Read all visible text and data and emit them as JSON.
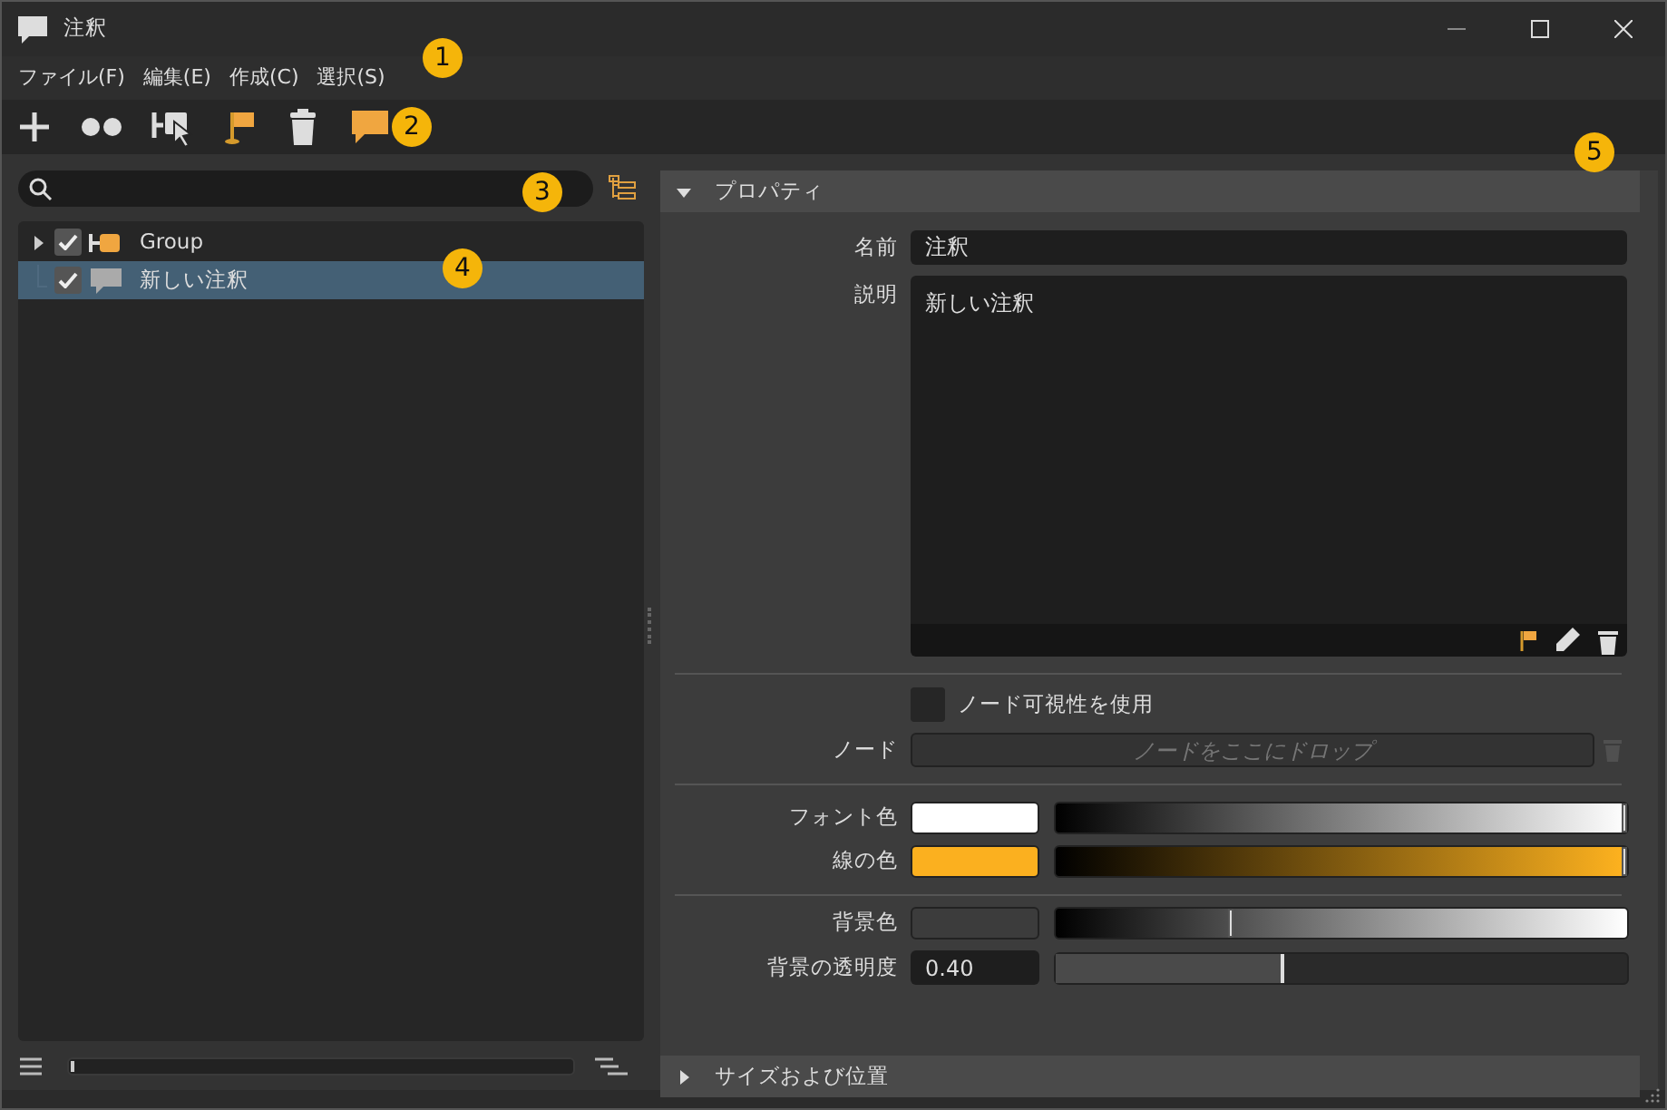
{
  "window": {
    "title": "注釈"
  },
  "menu": [
    {
      "label": "ファイル(F)"
    },
    {
      "label": "編集(E)"
    },
    {
      "label": "作成(C)"
    },
    {
      "label": "選択(S)"
    }
  ],
  "callouts": [
    "1",
    "2",
    "3",
    "4",
    "5"
  ],
  "tree": [
    {
      "label": "Group",
      "kind": "group",
      "checked": true,
      "expanded": false,
      "selected": false
    },
    {
      "label": "新しい注釈",
      "kind": "note",
      "checked": true,
      "selected": true
    }
  ],
  "properties_section": {
    "title": "プロパティ",
    "expanded": true
  },
  "name": {
    "label": "名前",
    "value": "注釈"
  },
  "description": {
    "label": "説明",
    "value": "新しい注釈"
  },
  "use_node_visibility": {
    "label": "ノード可視性を使用",
    "checked": false
  },
  "node": {
    "label": "ノード",
    "placeholder": "ノードをここにドロップ"
  },
  "colors": [
    {
      "label": "フォント色",
      "color": "#ffffff",
      "level": 1.0
    },
    {
      "label": "線の色",
      "color": "#fbb01f",
      "level": 1.0
    },
    {
      "label": "背景色",
      "color": "#3c3c3c",
      "level": 0.31
    }
  ],
  "opacity": {
    "label": "背景の透明度",
    "value": "0.40",
    "level": 0.4
  },
  "size_section": {
    "title": "サイズおよび位置",
    "expanded": false
  }
}
